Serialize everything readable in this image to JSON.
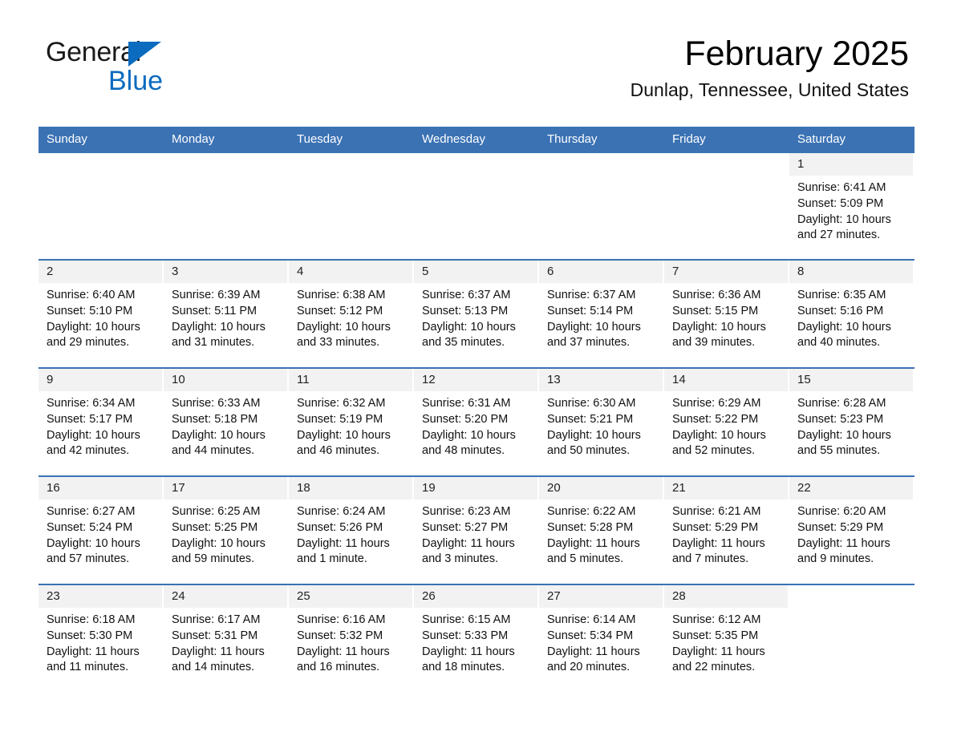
{
  "brand": {
    "word1": "General",
    "word2": "Blue",
    "triangle_color": "#0b6bbf"
  },
  "header": {
    "title": "February 2025",
    "subtitle": "Dunlap, Tennessee, United States",
    "header_color": "#3b72b4",
    "daynum_band_color": "#f2f2f2"
  },
  "weekdays": [
    "Sunday",
    "Monday",
    "Tuesday",
    "Wednesday",
    "Thursday",
    "Friday",
    "Saturday"
  ],
  "weeks": [
    [
      {
        "day": "",
        "blank": true
      },
      {
        "day": "",
        "blank": true
      },
      {
        "day": "",
        "blank": true
      },
      {
        "day": "",
        "blank": true
      },
      {
        "day": "",
        "blank": true
      },
      {
        "day": "",
        "blank": true
      },
      {
        "day": "1",
        "sunrise": "Sunrise: 6:41 AM",
        "sunset": "Sunset: 5:09 PM",
        "daylight1": "Daylight: 10 hours",
        "daylight2": "and 27 minutes."
      }
    ],
    [
      {
        "day": "2",
        "sunrise": "Sunrise: 6:40 AM",
        "sunset": "Sunset: 5:10 PM",
        "daylight1": "Daylight: 10 hours",
        "daylight2": "and 29 minutes."
      },
      {
        "day": "3",
        "sunrise": "Sunrise: 6:39 AM",
        "sunset": "Sunset: 5:11 PM",
        "daylight1": "Daylight: 10 hours",
        "daylight2": "and 31 minutes."
      },
      {
        "day": "4",
        "sunrise": "Sunrise: 6:38 AM",
        "sunset": "Sunset: 5:12 PM",
        "daylight1": "Daylight: 10 hours",
        "daylight2": "and 33 minutes."
      },
      {
        "day": "5",
        "sunrise": "Sunrise: 6:37 AM",
        "sunset": "Sunset: 5:13 PM",
        "daylight1": "Daylight: 10 hours",
        "daylight2": "and 35 minutes."
      },
      {
        "day": "6",
        "sunrise": "Sunrise: 6:37 AM",
        "sunset": "Sunset: 5:14 PM",
        "daylight1": "Daylight: 10 hours",
        "daylight2": "and 37 minutes."
      },
      {
        "day": "7",
        "sunrise": "Sunrise: 6:36 AM",
        "sunset": "Sunset: 5:15 PM",
        "daylight1": "Daylight: 10 hours",
        "daylight2": "and 39 minutes."
      },
      {
        "day": "8",
        "sunrise": "Sunrise: 6:35 AM",
        "sunset": "Sunset: 5:16 PM",
        "daylight1": "Daylight: 10 hours",
        "daylight2": "and 40 minutes."
      }
    ],
    [
      {
        "day": "9",
        "sunrise": "Sunrise: 6:34 AM",
        "sunset": "Sunset: 5:17 PM",
        "daylight1": "Daylight: 10 hours",
        "daylight2": "and 42 minutes."
      },
      {
        "day": "10",
        "sunrise": "Sunrise: 6:33 AM",
        "sunset": "Sunset: 5:18 PM",
        "daylight1": "Daylight: 10 hours",
        "daylight2": "and 44 minutes."
      },
      {
        "day": "11",
        "sunrise": "Sunrise: 6:32 AM",
        "sunset": "Sunset: 5:19 PM",
        "daylight1": "Daylight: 10 hours",
        "daylight2": "and 46 minutes."
      },
      {
        "day": "12",
        "sunrise": "Sunrise: 6:31 AM",
        "sunset": "Sunset: 5:20 PM",
        "daylight1": "Daylight: 10 hours",
        "daylight2": "and 48 minutes."
      },
      {
        "day": "13",
        "sunrise": "Sunrise: 6:30 AM",
        "sunset": "Sunset: 5:21 PM",
        "daylight1": "Daylight: 10 hours",
        "daylight2": "and 50 minutes."
      },
      {
        "day": "14",
        "sunrise": "Sunrise: 6:29 AM",
        "sunset": "Sunset: 5:22 PM",
        "daylight1": "Daylight: 10 hours",
        "daylight2": "and 52 minutes."
      },
      {
        "day": "15",
        "sunrise": "Sunrise: 6:28 AM",
        "sunset": "Sunset: 5:23 PM",
        "daylight1": "Daylight: 10 hours",
        "daylight2": "and 55 minutes."
      }
    ],
    [
      {
        "day": "16",
        "sunrise": "Sunrise: 6:27 AM",
        "sunset": "Sunset: 5:24 PM",
        "daylight1": "Daylight: 10 hours",
        "daylight2": "and 57 minutes."
      },
      {
        "day": "17",
        "sunrise": "Sunrise: 6:25 AM",
        "sunset": "Sunset: 5:25 PM",
        "daylight1": "Daylight: 10 hours",
        "daylight2": "and 59 minutes."
      },
      {
        "day": "18",
        "sunrise": "Sunrise: 6:24 AM",
        "sunset": "Sunset: 5:26 PM",
        "daylight1": "Daylight: 11 hours",
        "daylight2": "and 1 minute."
      },
      {
        "day": "19",
        "sunrise": "Sunrise: 6:23 AM",
        "sunset": "Sunset: 5:27 PM",
        "daylight1": "Daylight: 11 hours",
        "daylight2": "and 3 minutes."
      },
      {
        "day": "20",
        "sunrise": "Sunrise: 6:22 AM",
        "sunset": "Sunset: 5:28 PM",
        "daylight1": "Daylight: 11 hours",
        "daylight2": "and 5 minutes."
      },
      {
        "day": "21",
        "sunrise": "Sunrise: 6:21 AM",
        "sunset": "Sunset: 5:29 PM",
        "daylight1": "Daylight: 11 hours",
        "daylight2": "and 7 minutes."
      },
      {
        "day": "22",
        "sunrise": "Sunrise: 6:20 AM",
        "sunset": "Sunset: 5:29 PM",
        "daylight1": "Daylight: 11 hours",
        "daylight2": "and 9 minutes."
      }
    ],
    [
      {
        "day": "23",
        "sunrise": "Sunrise: 6:18 AM",
        "sunset": "Sunset: 5:30 PM",
        "daylight1": "Daylight: 11 hours",
        "daylight2": "and 11 minutes."
      },
      {
        "day": "24",
        "sunrise": "Sunrise: 6:17 AM",
        "sunset": "Sunset: 5:31 PM",
        "daylight1": "Daylight: 11 hours",
        "daylight2": "and 14 minutes."
      },
      {
        "day": "25",
        "sunrise": "Sunrise: 6:16 AM",
        "sunset": "Sunset: 5:32 PM",
        "daylight1": "Daylight: 11 hours",
        "daylight2": "and 16 minutes."
      },
      {
        "day": "26",
        "sunrise": "Sunrise: 6:15 AM",
        "sunset": "Sunset: 5:33 PM",
        "daylight1": "Daylight: 11 hours",
        "daylight2": "and 18 minutes."
      },
      {
        "day": "27",
        "sunrise": "Sunrise: 6:14 AM",
        "sunset": "Sunset: 5:34 PM",
        "daylight1": "Daylight: 11 hours",
        "daylight2": "and 20 minutes."
      },
      {
        "day": "28",
        "sunrise": "Sunrise: 6:12 AM",
        "sunset": "Sunset: 5:35 PM",
        "daylight1": "Daylight: 11 hours",
        "daylight2": "and 22 minutes."
      },
      {
        "day": "",
        "blank": true
      }
    ]
  ]
}
